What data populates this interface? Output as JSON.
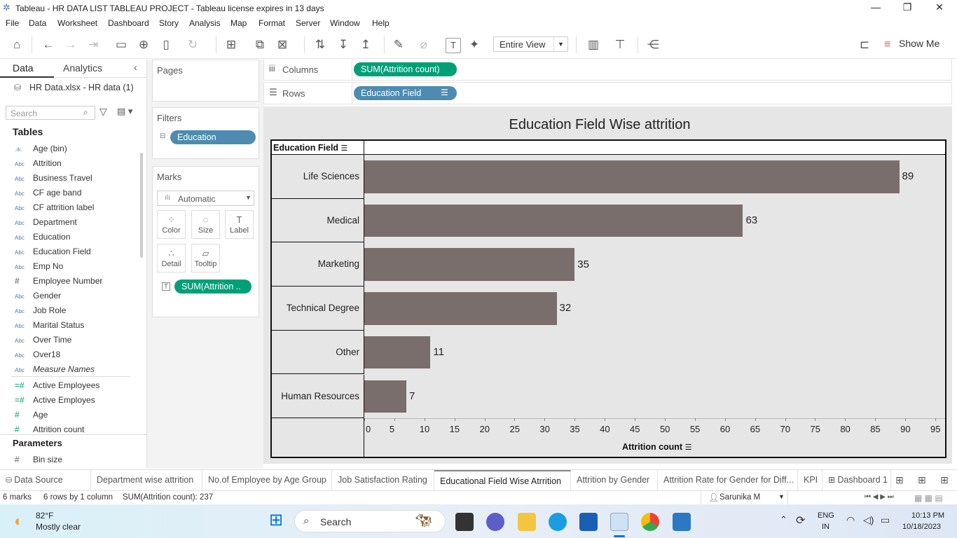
{
  "window": {
    "title": "Tableau - HR DATA LIST TABLEAU PROJECT - Tableau license expires in 13 days",
    "minimize": "—",
    "restore": "❐",
    "close": "✕"
  },
  "menu": [
    "File",
    "Data",
    "Worksheet",
    "Dashboard",
    "Story",
    "Analysis",
    "Map",
    "Format",
    "Server",
    "Window",
    "Help"
  ],
  "toolbar": {
    "view_mode": "Entire View",
    "show_me": "Show Me"
  },
  "left_panel": {
    "tab_data": "Data",
    "tab_analytics": "Analytics",
    "data_source": "HR Data.xlsx - HR data (1)",
    "search_placeholder": "Search",
    "tables_heading": "Tables",
    "fields": [
      {
        "icon": ".ılı.",
        "name": "Age (bin)"
      },
      {
        "icon": "Abc",
        "name": "Attrition"
      },
      {
        "icon": "Abc",
        "name": "Business Travel"
      },
      {
        "icon": "Abc",
        "name": "CF age band"
      },
      {
        "icon": "Abc",
        "name": "CF attrition label"
      },
      {
        "icon": "Abc",
        "name": "Department"
      },
      {
        "icon": "Abc",
        "name": "Education"
      },
      {
        "icon": "Abc",
        "name": "Education Field"
      },
      {
        "icon": "Abc",
        "name": "Emp No"
      },
      {
        "icon": "#",
        "name": "Employee Number"
      },
      {
        "icon": "Abc",
        "name": "Gender"
      },
      {
        "icon": "Abc",
        "name": "Job Role"
      },
      {
        "icon": "Abc",
        "name": "Marital Status"
      },
      {
        "icon": "Abc",
        "name": "Over Time"
      },
      {
        "icon": "Abc",
        "name": "Over18"
      },
      {
        "icon": "Abc",
        "name": "Measure Names"
      }
    ],
    "measures": [
      {
        "icon": "=#",
        "name": "Active Employees"
      },
      {
        "icon": "=#",
        "name": "Active Employes"
      },
      {
        "icon": "#",
        "name": "Age"
      },
      {
        "icon": "#",
        "name": "Attrition count"
      }
    ],
    "parameters_heading": "Parameters",
    "parameters": [
      {
        "icon": "#",
        "name": "Bin size"
      }
    ]
  },
  "cards": {
    "pages_label": "Pages",
    "filters_label": "Filters",
    "filter_pill": "Education",
    "marks_label": "Marks",
    "mark_type": "Automatic",
    "buttons": {
      "color": "Color",
      "size": "Size",
      "label": "Label",
      "detail": "Detail",
      "tooltip": "Tooltip"
    },
    "label_pill": "SUM(Attrition .."
  },
  "shelves": {
    "columns_label": "Columns",
    "columns_pill": "SUM(Attrition count)",
    "rows_label": "Rows",
    "rows_pill": "Education Field"
  },
  "colors": {
    "bar": "#7a6e6d",
    "pill_green": "#00a077",
    "pill_blue": "#4d8cb0"
  },
  "chart_data": {
    "type": "bar",
    "orientation": "horizontal",
    "title": "Education Field Wise attrition",
    "row_header": "Education Field",
    "xlabel": "Attrition count",
    "categories": [
      "Life Sciences",
      "Medical",
      "Marketing",
      "Technical Degree",
      "Other",
      "Human Resources"
    ],
    "values": [
      89,
      63,
      35,
      32,
      11,
      7
    ],
    "xlim": [
      0,
      95
    ],
    "xticks": [
      0,
      5,
      10,
      15,
      20,
      25,
      30,
      35,
      40,
      45,
      50,
      55,
      60,
      65,
      70,
      75,
      80,
      85,
      90,
      95
    ]
  },
  "sheet_tabs": [
    "Data Source",
    "Department wise attrition",
    "No.of Employee by Age Group",
    "Job Satisfaction Rating",
    "Educational Field Wise Atrrition",
    "Attrition by Gender",
    "Attrition Rate for Gender for Diff...",
    "KPI",
    "Dashboard 1"
  ],
  "active_tab": "Educational Field Wise Atrrition",
  "status": {
    "marks": "6 marks",
    "rows_cols": "6 rows by 1 column",
    "sum": "SUM(Attrition count): 237",
    "user": "Sarunika M"
  },
  "taskbar": {
    "temp": "82°F",
    "weather": "Mostly clear",
    "search": "Search",
    "lang1": "ENG",
    "lang2": "IN",
    "time": "10:13 PM",
    "date": "10/18/2023"
  }
}
